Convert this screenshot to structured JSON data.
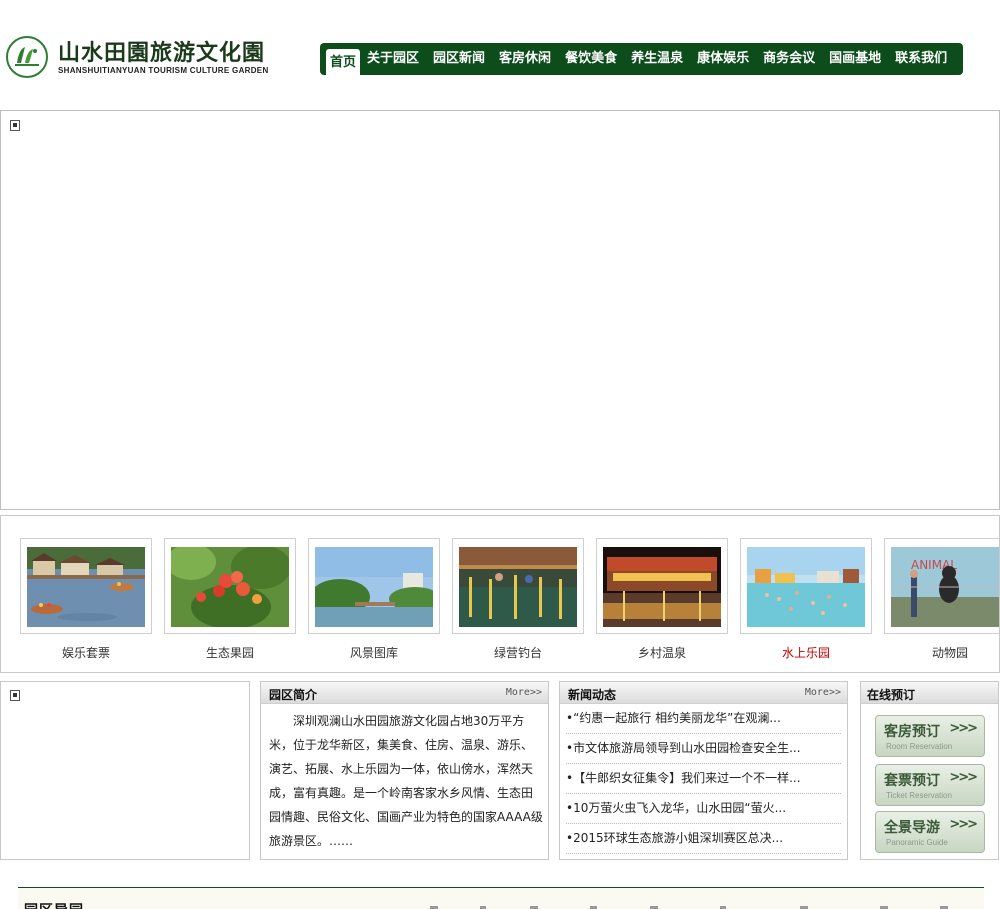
{
  "header": {
    "logo_cn": "山水田園旅游文化園",
    "logo_en": "SHANSHUITIANYUAN TOURISM CULTURE GARDEN",
    "nav": [
      {
        "label": "首页",
        "active": true
      },
      {
        "label": "关于园区"
      },
      {
        "label": "园区新闻"
      },
      {
        "label": "客房休闲"
      },
      {
        "label": "餐饮美食"
      },
      {
        "label": "养生温泉"
      },
      {
        "label": "康体娱乐"
      },
      {
        "label": "商务会议"
      },
      {
        "label": "国画基地"
      },
      {
        "label": "联系我们"
      }
    ]
  },
  "gallery": [
    {
      "label": "娱乐套票",
      "scene": "lake-village"
    },
    {
      "label": "生态果园",
      "scene": "fruit"
    },
    {
      "label": "风景图库",
      "scene": "scenery"
    },
    {
      "label": "绿营钓台",
      "scene": "fishing"
    },
    {
      "label": "乡村温泉",
      "scene": "hot-spring"
    },
    {
      "label": "水上乐园",
      "scene": "water-park",
      "highlight": true
    },
    {
      "label": "动物园",
      "scene": "zoo"
    }
  ],
  "intro": {
    "title": "园区简介",
    "more": "More>>",
    "text": "深圳观澜山水田园旅游文化园占地30万平方米，位于龙华新区，集美食、住房、温泉、游乐、演艺、拓展、水上乐园为一体，依山傍水，浑然天成，富有真趣。是一个岭南客家水乡风情、生态田园情趣、民俗文化、国画产业为特色的国家AAAA级旅游景区。……"
  },
  "news": {
    "title": "新闻动态",
    "more": "More>>",
    "items": [
      "•“约惠一起旅行 相约美丽龙华”在观澜...",
      "•市文体旅游局领导到山水田园检查安全生...",
      "•【牛郎织女征集令】我们来过一个不一样...",
      "•10万萤火虫飞入龙华，山水田园“萤火...",
      "•2015环球生态旅游小姐深圳赛区总决..."
    ]
  },
  "booking": {
    "title": "在线预订",
    "buttons": [
      {
        "label": "客房预订",
        "sub": "Room Reservation",
        "arrow": ">>>"
      },
      {
        "label": "套票预订",
        "sub": "Ticket Reservation",
        "arrow": ">>>"
      },
      {
        "label": "全景导游",
        "sub": "Panoramic Guide",
        "arrow": ">>>"
      }
    ]
  },
  "footer": {
    "title": "园区导园"
  },
  "colors": {
    "nav_bg": "#0d4d1c",
    "highlight_red": "#c00000"
  }
}
